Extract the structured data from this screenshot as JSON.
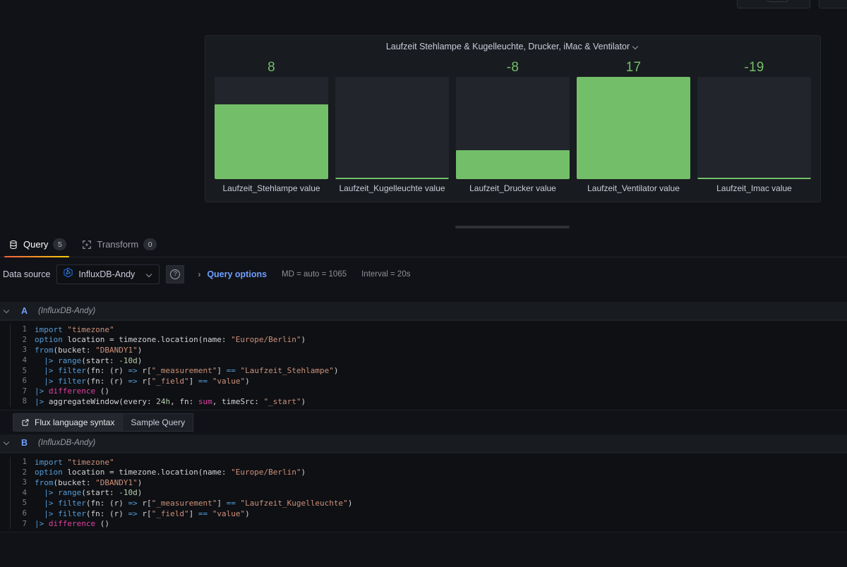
{
  "window": {
    "top_buttons": [
      "",
      ""
    ]
  },
  "panel": {
    "title": "Laufzeit Stehlampe & Kugelleuchte, Drucker, iMac & Ventilator",
    "menu_icon": "chevron-down-icon"
  },
  "chart_data": {
    "type": "bar",
    "title": "Laufzeit Stehlampe & Kugelleuchte, Drucker, iMac & Ventilator",
    "orientation": "vertical",
    "categories": [
      "Laufzeit_Stehlampe value",
      "Laufzeit_Kugelleuchte value",
      "Laufzeit_Drucker value",
      "Laufzeit_Ventilator value",
      "Laufzeit_Imac value"
    ],
    "values": [
      8,
      null,
      -8,
      17,
      -19
    ],
    "display_values": [
      "8",
      "",
      "-8",
      "17",
      "-19"
    ],
    "fill_percent": [
      73,
      0,
      28,
      100,
      1
    ],
    "bar_color": "#73bf69",
    "track_color": "#22252b",
    "value_color": "#73bf69",
    "xlabel": "",
    "ylabel": "",
    "grid": false,
    "legend": "none"
  },
  "editor_tabs": [
    {
      "label": "Query",
      "badge": "5",
      "icon": "database-icon",
      "active": true
    },
    {
      "label": "Transform",
      "badge": "0",
      "icon": "transform-icon",
      "active": false
    }
  ],
  "datasource_row": {
    "label": "Data source",
    "selected": "InfluxDB-Andy",
    "picker_icon": "influxdb-icon",
    "chevron_icon": "chevron-down-icon",
    "help_icon": "question-circle-icon",
    "expand_icon": "chevron-right-icon",
    "query_options_label": "Query options",
    "md_text": "MD = auto = 1065",
    "interval_text": "Interval = 20s"
  },
  "queries": [
    {
      "letter": "A",
      "datasource": "(InfluxDB-Andy)",
      "collapse_icon": "chevron-down-icon",
      "lines": [
        [
          {
            "t": "import ",
            "c": "k-kw"
          },
          {
            "t": "\"timezone\"",
            "c": "k-str"
          }
        ],
        [
          {
            "t": "option ",
            "c": "k-kw"
          },
          {
            "t": "location = timezone.location(name: ",
            "c": "k-plain"
          },
          {
            "t": "\"Europe/Berlin\"",
            "c": "k-str"
          },
          {
            "t": ")",
            "c": "k-plain"
          }
        ],
        [
          {
            "t": "from",
            "c": "k-kw"
          },
          {
            "t": "(bucket: ",
            "c": "k-plain"
          },
          {
            "t": "\"DBANDY1\"",
            "c": "k-str"
          },
          {
            "t": ")",
            "c": "k-plain"
          }
        ],
        [
          {
            "t": "  |> ",
            "c": "k-pipe"
          },
          {
            "t": "range",
            "c": "k-kw"
          },
          {
            "t": "(start: ",
            "c": "k-plain"
          },
          {
            "t": "-10d",
            "c": "k-num"
          },
          {
            "t": ")",
            "c": "k-plain"
          }
        ],
        [
          {
            "t": "  |> ",
            "c": "k-pipe"
          },
          {
            "t": "filter",
            "c": "k-kw"
          },
          {
            "t": "(fn: (r) ",
            "c": "k-plain"
          },
          {
            "t": "=>",
            "c": "k-op"
          },
          {
            "t": " r[",
            "c": "k-plain"
          },
          {
            "t": "\"_measurement\"",
            "c": "k-str"
          },
          {
            "t": "] ",
            "c": "k-plain"
          },
          {
            "t": "==",
            "c": "k-op"
          },
          {
            "t": " ",
            "c": "k-plain"
          },
          {
            "t": "\"Laufzeit_Stehlampe\"",
            "c": "k-str"
          },
          {
            "t": ")",
            "c": "k-plain"
          }
        ],
        [
          {
            "t": "  |> ",
            "c": "k-pipe"
          },
          {
            "t": "filter",
            "c": "k-kw"
          },
          {
            "t": "(fn: (r) ",
            "c": "k-plain"
          },
          {
            "t": "=>",
            "c": "k-op"
          },
          {
            "t": " r[",
            "c": "k-plain"
          },
          {
            "t": "\"_field\"",
            "c": "k-str"
          },
          {
            "t": "] ",
            "c": "k-plain"
          },
          {
            "t": "==",
            "c": "k-op"
          },
          {
            "t": " ",
            "c": "k-plain"
          },
          {
            "t": "\"value\"",
            "c": "k-str"
          },
          {
            "t": ")",
            "c": "k-plain"
          }
        ],
        [
          {
            "t": "|> ",
            "c": "k-pipe"
          },
          {
            "t": "difference",
            "c": "k-mag"
          },
          {
            "t": " ()",
            "c": "k-plain"
          }
        ],
        [
          {
            "t": "|> ",
            "c": "k-pipe"
          },
          {
            "t": "aggregateWindow(every: ",
            "c": "k-plain"
          },
          {
            "t": "24h",
            "c": "k-num"
          },
          {
            "t": ", fn: ",
            "c": "k-plain"
          },
          {
            "t": "sum",
            "c": "k-mag"
          },
          {
            "t": ", timeSrc: ",
            "c": "k-plain"
          },
          {
            "t": "\"_start\"",
            "c": "k-str"
          },
          {
            "t": ")",
            "c": "k-plain"
          }
        ]
      ]
    },
    {
      "letter": "B",
      "datasource": "(InfluxDB-Andy)",
      "collapse_icon": "chevron-down-icon",
      "lines": [
        [
          {
            "t": "import ",
            "c": "k-kw"
          },
          {
            "t": "\"timezone\"",
            "c": "k-str"
          }
        ],
        [
          {
            "t": "option ",
            "c": "k-kw"
          },
          {
            "t": "location = timezone.location(name: ",
            "c": "k-plain"
          },
          {
            "t": "\"Europe/Berlin\"",
            "c": "k-str"
          },
          {
            "t": ")",
            "c": "k-plain"
          }
        ],
        [
          {
            "t": "from",
            "c": "k-kw"
          },
          {
            "t": "(bucket: ",
            "c": "k-plain"
          },
          {
            "t": "\"DBANDY1\"",
            "c": "k-str"
          },
          {
            "t": ")",
            "c": "k-plain"
          }
        ],
        [
          {
            "t": "  |> ",
            "c": "k-pipe"
          },
          {
            "t": "range",
            "c": "k-kw"
          },
          {
            "t": "(start: ",
            "c": "k-plain"
          },
          {
            "t": "-10d",
            "c": "k-num"
          },
          {
            "t": ")",
            "c": "k-plain"
          }
        ],
        [
          {
            "t": "  |> ",
            "c": "k-pipe"
          },
          {
            "t": "filter",
            "c": "k-kw"
          },
          {
            "t": "(fn: (r) ",
            "c": "k-plain"
          },
          {
            "t": "=>",
            "c": "k-op"
          },
          {
            "t": " r[",
            "c": "k-plain"
          },
          {
            "t": "\"_measurement\"",
            "c": "k-str"
          },
          {
            "t": "] ",
            "c": "k-plain"
          },
          {
            "t": "==",
            "c": "k-op"
          },
          {
            "t": " ",
            "c": "k-plain"
          },
          {
            "t": "\"Laufzeit_Kugelleuchte\"",
            "c": "k-str"
          },
          {
            "t": ")",
            "c": "k-plain"
          }
        ],
        [
          {
            "t": "  |> ",
            "c": "k-pipe"
          },
          {
            "t": "filter",
            "c": "k-kw"
          },
          {
            "t": "(fn: (r) ",
            "c": "k-plain"
          },
          {
            "t": "=>",
            "c": "k-op"
          },
          {
            "t": " r[",
            "c": "k-plain"
          },
          {
            "t": "\"_field\"",
            "c": "k-str"
          },
          {
            "t": "] ",
            "c": "k-plain"
          },
          {
            "t": "==",
            "c": "k-op"
          },
          {
            "t": " ",
            "c": "k-plain"
          },
          {
            "t": "\"value\"",
            "c": "k-str"
          },
          {
            "t": ")",
            "c": "k-plain"
          }
        ],
        [
          {
            "t": "|> ",
            "c": "k-pipe"
          },
          {
            "t": "difference",
            "c": "k-mag"
          },
          {
            "t": " ()",
            "c": "k-plain"
          }
        ]
      ]
    }
  ],
  "flux_row": {
    "syntax_label": "Flux language syntax",
    "syntax_icon": "external-link-icon",
    "sample_label": "Sample Query"
  }
}
